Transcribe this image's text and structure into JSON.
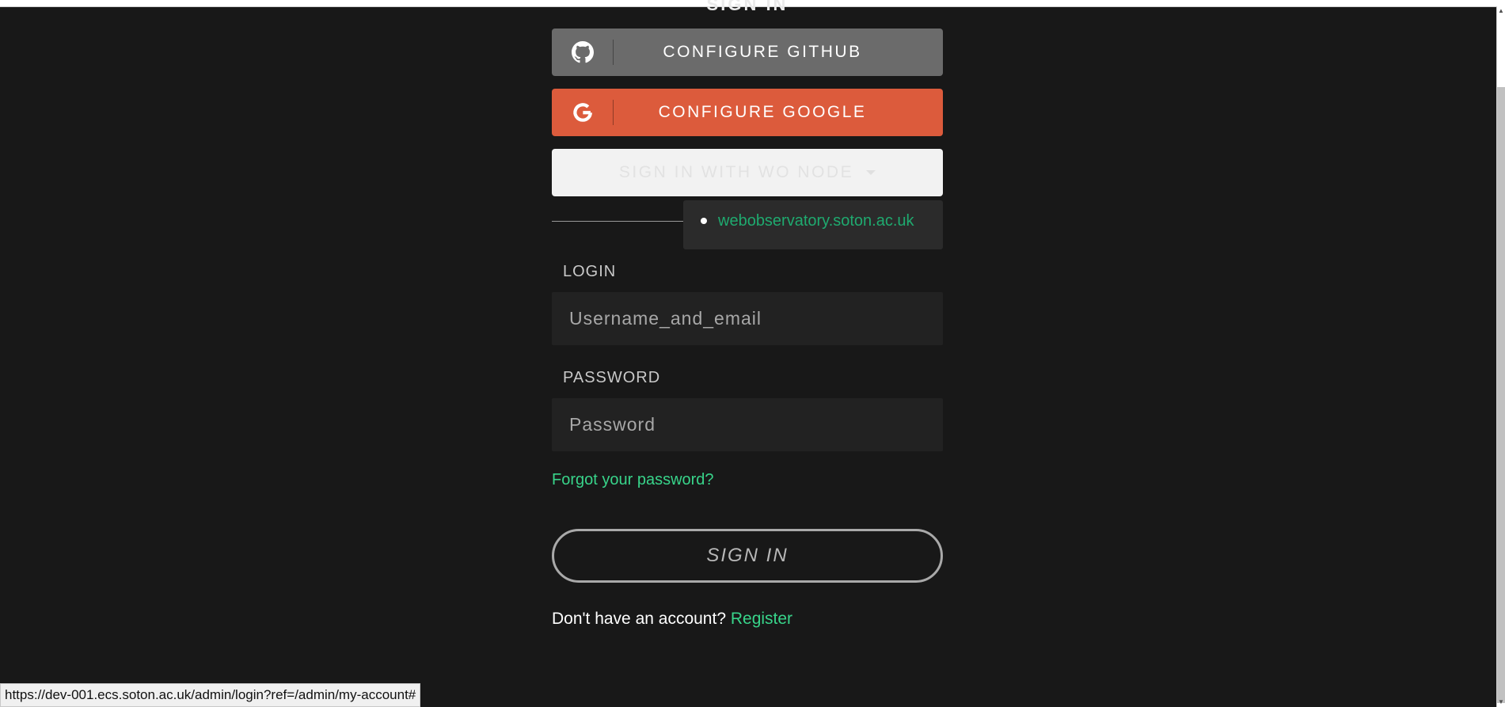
{
  "page": {
    "title": "SIGN IN"
  },
  "social": {
    "github_label": "CONFIGURE GITHUB",
    "google_label": "CONFIGURE GOOGLE",
    "wo_node_label": "SIGN IN WITH WO NODE"
  },
  "wo_node_dropdown": {
    "options": [
      "webobservatory.soton.ac.uk"
    ]
  },
  "login": {
    "label": "LOGIN",
    "placeholder": "Username_and_email",
    "value": ""
  },
  "password": {
    "label": "PASSWORD",
    "placeholder": "Password",
    "value": ""
  },
  "forgot_label": "Forgot your password?",
  "submit_label": "SIGN IN",
  "register": {
    "prompt": "Don't have an account?",
    "link": "Register"
  },
  "statusbar": {
    "url": "https://dev-001.ecs.soton.ac.uk/admin/login?ref=/admin/my-account#"
  },
  "colors": {
    "background": "#181818",
    "github": "#6b6b6b",
    "google": "#dc5b3c",
    "accent": "#38d48a"
  }
}
